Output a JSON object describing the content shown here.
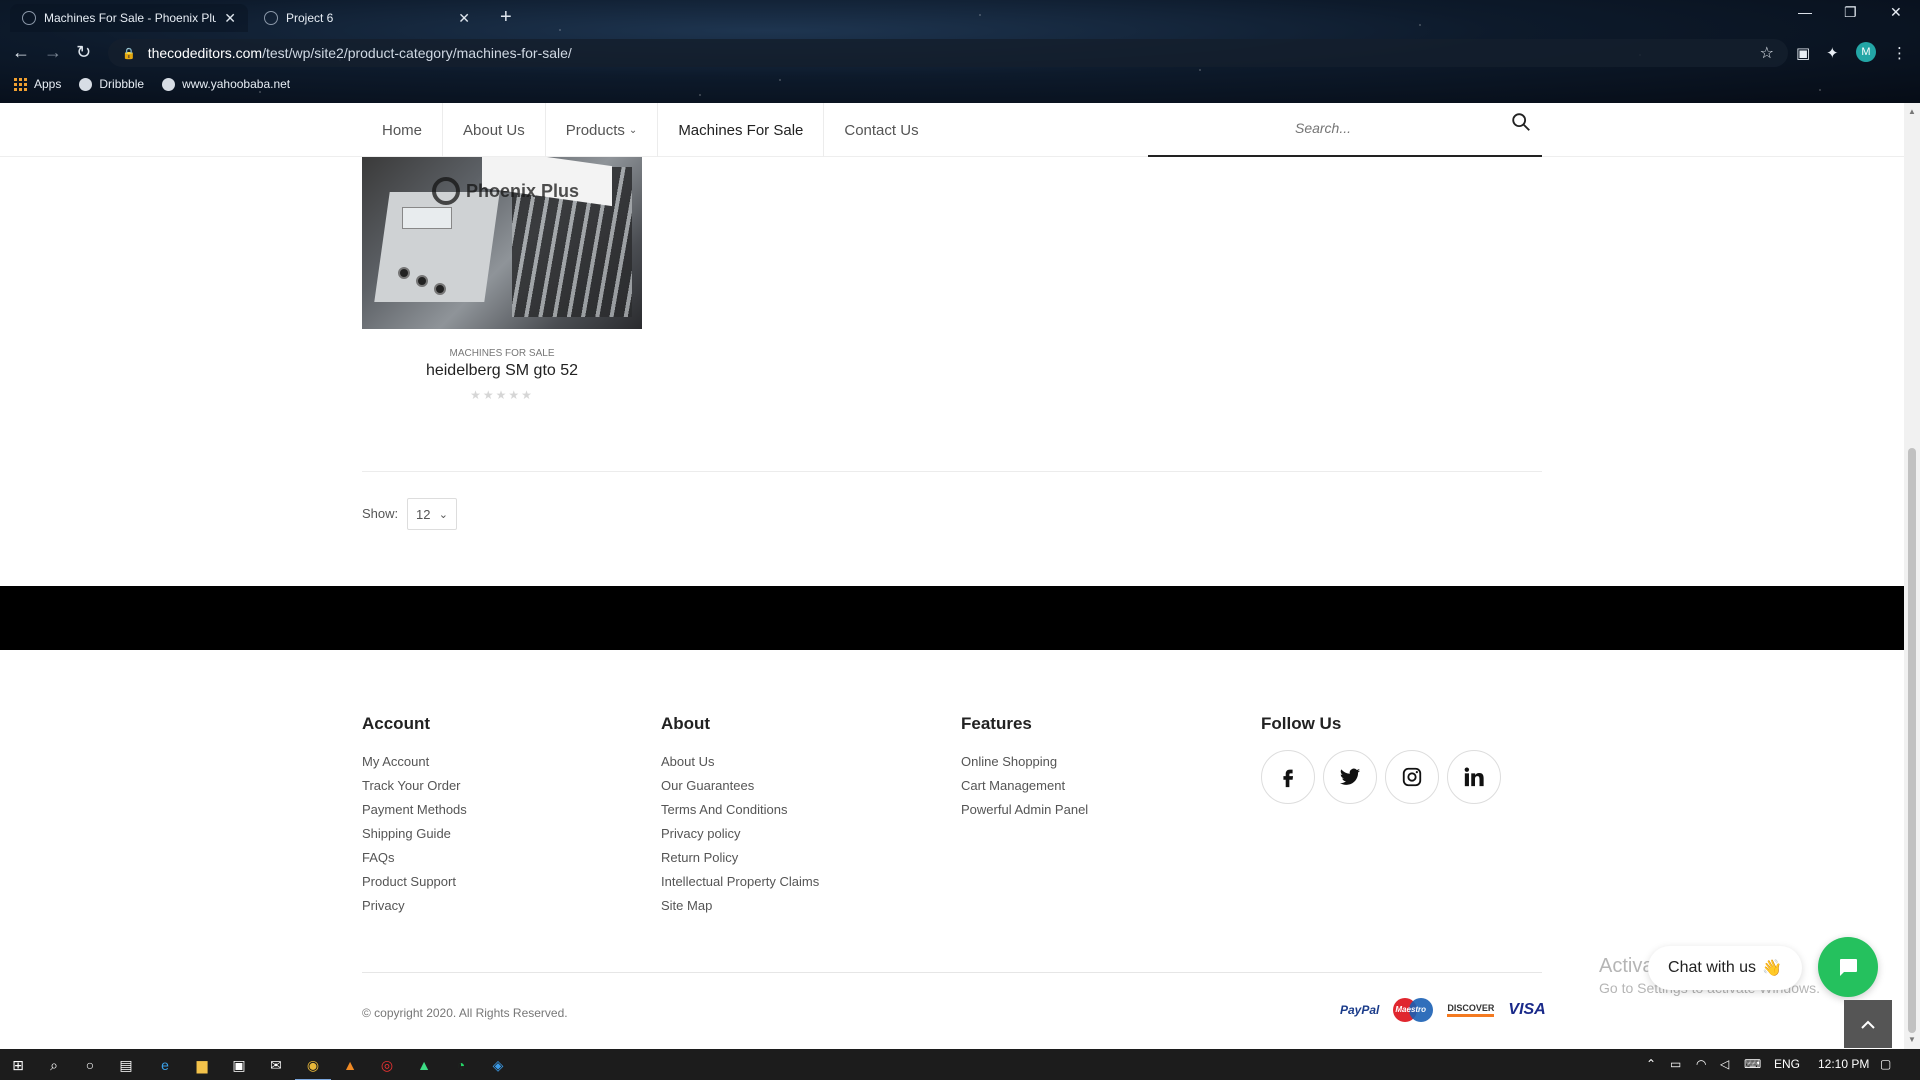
{
  "browser": {
    "tabs": [
      {
        "title": "Machines For Sale - Phoenix Plus",
        "active": true
      },
      {
        "title": "Project 6",
        "active": false
      }
    ],
    "url_host": "thecodeditors.com",
    "url_path": "/test/wp/site2/product-category/machines-for-sale/",
    "profile_initial": "M",
    "bookmarks": [
      {
        "label": "Apps",
        "icon": "apps-grid-icon"
      },
      {
        "label": "Dribbble",
        "icon": "dribbble-icon"
      },
      {
        "label": "www.yahoobaba.net",
        "icon": "globe-icon"
      }
    ]
  },
  "nav": {
    "items": [
      {
        "label": "Home"
      },
      {
        "label": "About Us"
      },
      {
        "label": "Products",
        "has_dropdown": true
      },
      {
        "label": "Machines For Sale",
        "current": true
      },
      {
        "label": "Contact Us"
      }
    ],
    "search_placeholder": "Search..."
  },
  "product": {
    "image_watermark": "Phoenix Plus",
    "category": "MACHINES FOR SALE",
    "name": "heidelberg SM gto 52",
    "rating": 0,
    "rating_max": 5
  },
  "pagination": {
    "show_label": "Show:",
    "per_page": "12"
  },
  "footer": {
    "account": {
      "title": "Account",
      "links": [
        "My Account",
        "Track Your Order",
        "Payment Methods",
        "Shipping Guide",
        "FAQs",
        "Product Support",
        "Privacy"
      ]
    },
    "about": {
      "title": "About",
      "links": [
        "About Us",
        "Our Guarantees",
        "Terms And Conditions",
        "Privacy policy",
        "Return Policy",
        "Intellectual Property Claims",
        "Site Map"
      ]
    },
    "features": {
      "title": "Features",
      "links": [
        "Online Shopping",
        "Cart Management",
        "Powerful Admin Panel"
      ]
    },
    "follow": {
      "title": "Follow Us",
      "networks": [
        "facebook-icon",
        "twitter-icon",
        "instagram-icon",
        "linkedin-icon"
      ]
    },
    "copyright": "© copyright 2020. All Rights Reserved.",
    "payments": {
      "paypal": "PayPal",
      "maestro": "Maestro",
      "discover": "DISCOVER",
      "visa": "VISA"
    }
  },
  "overlays": {
    "chat_label": "Chat with us",
    "chat_emoji": "👋",
    "activate_title": "Activate Windows",
    "activate_sub": "Go to Settings to activate Windows."
  },
  "taskbar": {
    "language": "ENG",
    "time": "12:10 PM"
  },
  "colors": {
    "footer_bar": "#000000",
    "chat_green": "#25c15e",
    "accent_text": "#222222"
  }
}
